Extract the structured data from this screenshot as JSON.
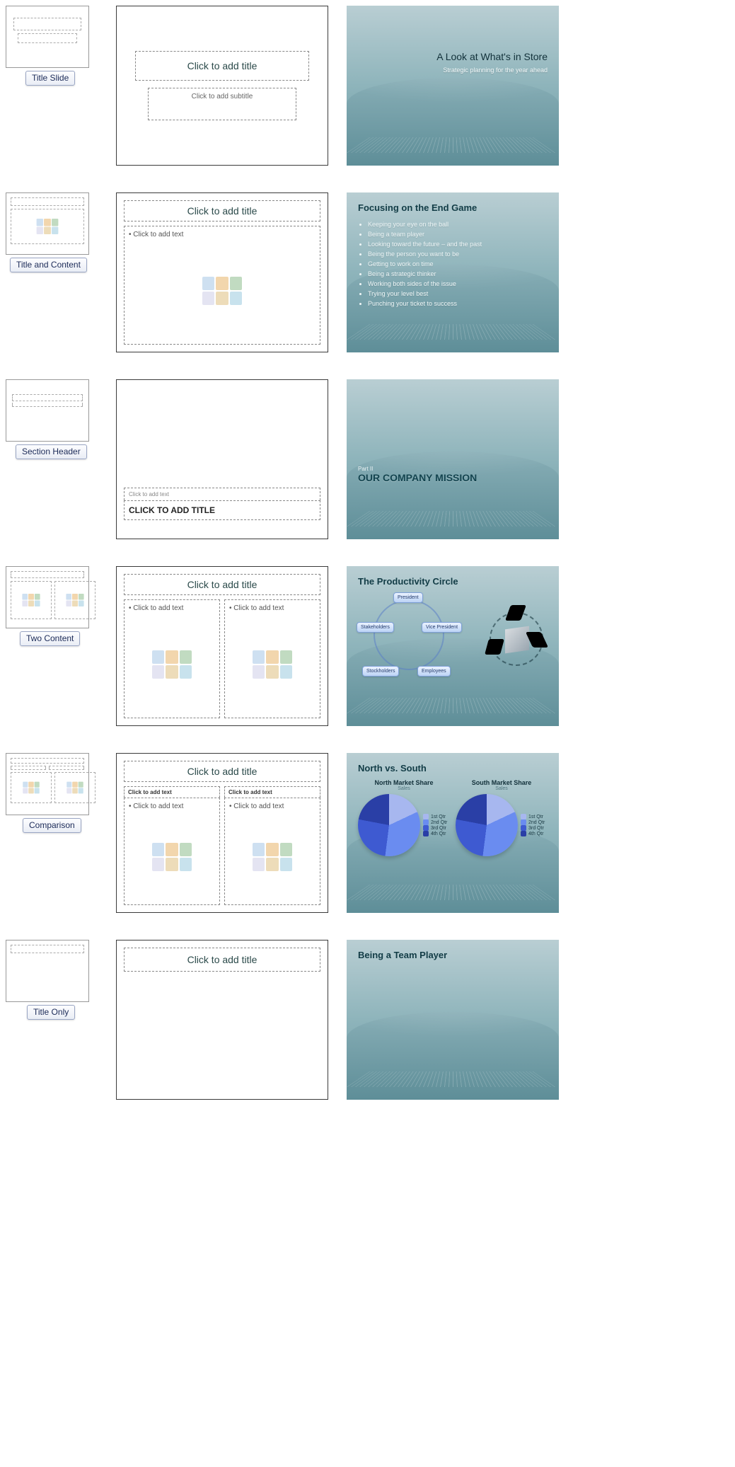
{
  "layouts": [
    {
      "tag": "Title Slide",
      "title_ph": "Click to add title",
      "sub_ph": "Click to add subtitle"
    },
    {
      "tag": "Title and Content",
      "title_ph": "Click to add title",
      "text_ph": "Click to add text"
    },
    {
      "tag": "Section Header",
      "title_ph": "CLICK TO ADD TITLE",
      "sub_ph": "Click to add text"
    },
    {
      "tag": "Two Content",
      "title_ph": "Click to add title",
      "text_ph_l": "Click to add text",
      "text_ph_r": "Click to add text"
    },
    {
      "tag": "Comparison",
      "title_ph": "Click to add title",
      "cap_l": "Click to add text",
      "text_ph_l": "Click to add text",
      "cap_r": "Click to add text",
      "text_ph_r": "Click to add text"
    },
    {
      "tag": "Title Only",
      "title_ph": "Click to add title"
    }
  ],
  "slides": {
    "title": {
      "heading": "A Look at What's in Store",
      "sub": "Strategic planning for the year ahead"
    },
    "content": {
      "heading": "Focusing on the End Game",
      "bullets": [
        "Keeping your eye on the ball",
        "Being a team player",
        "Looking toward the future – and the past",
        "Being the person you want to be",
        "Getting to work on time",
        "Being a strategic thinker",
        "Working both sides of the issue",
        "Trying your level best",
        "Punching your ticket to success"
      ]
    },
    "section": {
      "kicker": "Part II",
      "heading": "OUR COMPANY MISSION"
    },
    "two": {
      "heading": "The Productivity Circle",
      "nodes": [
        "President",
        "Stakeholders",
        "Vice President",
        "Stockholders",
        "Employees"
      ]
    },
    "compare": {
      "heading": "North vs. South",
      "left_title": "North Market Share",
      "right_title": "South Market Share",
      "series_label": "Sales",
      "legend": [
        "1st Qtr",
        "2nd Qtr",
        "3rd Qtr",
        "4th Qtr"
      ],
      "legend_colors": [
        "#a7b7ef",
        "#6a8cf0",
        "#3e5ad1",
        "#2a3fa6"
      ]
    },
    "titleonly": {
      "heading": "Being a Team Player"
    }
  },
  "chart_data": [
    {
      "type": "pie",
      "title": "North Market Share – Sales",
      "categories": [
        "1st Qtr",
        "2nd Qtr",
        "3rd Qtr",
        "4th Qtr"
      ],
      "values": [
        18,
        34,
        26,
        22
      ]
    },
    {
      "type": "pie",
      "title": "South Market Share – Sales",
      "categories": [
        "1st Qtr",
        "2nd Qtr",
        "3rd Qtr",
        "4th Qtr"
      ],
      "values": [
        18,
        34,
        26,
        22
      ]
    }
  ]
}
